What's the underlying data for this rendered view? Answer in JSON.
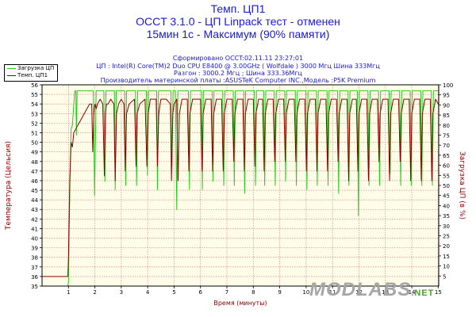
{
  "header": {
    "title_line1": "Темп. ЦП1",
    "title_line2": "OCCT 3.1.0 - ЦП Linpack тест - отменен",
    "title_line3": "15мин 1с - Максимум (90% памяти)",
    "info_line1": "Сформировано OCCT:02.11.11 23:27:01",
    "info_line2": "ЦП : Intel(R) Core(TM)2 Duo CPU E8400 @ 3.00GHz ( Wolfdale ) 3000 Мгц Шина 333Мгц",
    "info_line3": "Разгон : 3000.2 Мгц ; Шина 333.36Мгц",
    "info_line4": "Производитель материнской платы :ASUSTeK Computer INC.,Модель :P5K Premium"
  },
  "legend": {
    "load_label": "Загрузка ЦП",
    "temp_label": "Темп. ЦП1"
  },
  "watermark": {
    "main": "MODLABS",
    "suffix": ".NET"
  },
  "colors": {
    "load": "#22cc22",
    "temp": "#8b0000",
    "axis_left": "#8b0000",
    "axis_right": "#8b0000",
    "grid": "#c87878",
    "plot_bg": "#fffde8"
  },
  "chart_data": {
    "type": "line",
    "xlabel": "Время (минуты)",
    "ylabel_left": "Температура (Цельсия)",
    "ylabel_right": "Загрузка ЦП (в %)",
    "xlim": [
      0,
      15.02
    ],
    "ylim_left": [
      35,
      56
    ],
    "ylim_right": [
      0,
      100
    ],
    "x_ticks": [
      1,
      2,
      3,
      4,
      5,
      6,
      7,
      8,
      9,
      10,
      11,
      12,
      13,
      14,
      15
    ],
    "y_ticks_left": [
      35,
      36,
      37,
      38,
      39,
      40,
      41,
      42,
      43,
      44,
      45,
      46,
      47,
      48,
      49,
      50,
      51,
      52,
      53,
      54,
      55,
      56
    ],
    "y_ticks_right": [
      5,
      10,
      15,
      20,
      25,
      30,
      35,
      40,
      45,
      50,
      55,
      60,
      65,
      70,
      75,
      80,
      85,
      90,
      95,
      100
    ],
    "grid": true,
    "legend_position": "top-left",
    "series": [
      {
        "name": "Загрузка ЦП",
        "axis": "right",
        "x": [
          0,
          0.98,
          1.0,
          1.03,
          1.06,
          1.1,
          1.15,
          1.2,
          1.24,
          1.28,
          1.3,
          1.33,
          1.36,
          1.4,
          1.45,
          1.5,
          1.54,
          1.57,
          1.62,
          1.9,
          1.94,
          1.99,
          2.05,
          2.3,
          2.34,
          2.38,
          2.42,
          2.7,
          2.74,
          2.77,
          2.81,
          3.1,
          3.13,
          3.17,
          3.2,
          3.5,
          3.54,
          3.58,
          3.62,
          3.9,
          3.95,
          3.99,
          4.03,
          4.3,
          4.34,
          4.37,
          4.41,
          4.85,
          4.88,
          4.92,
          4.96,
          5.0,
          5.05,
          5.1,
          5.14,
          5.5,
          5.54,
          5.58,
          5.62,
          6.0,
          6.04,
          6.07,
          6.11,
          6.4,
          6.44,
          6.47,
          6.51,
          6.8,
          6.84,
          6.88,
          6.92,
          7.2,
          7.24,
          7.28,
          7.32,
          7.6,
          7.64,
          7.67,
          7.71,
          8.0,
          8.04,
          8.08,
          8.12,
          8.35,
          8.39,
          8.43,
          8.47,
          8.75,
          8.79,
          8.83,
          8.87,
          9.15,
          9.19,
          9.22,
          9.26,
          9.55,
          9.59,
          9.63,
          9.67,
          9.95,
          9.99,
          10.03,
          10.07,
          10.35,
          10.39,
          10.42,
          10.46,
          10.75,
          10.79,
          10.83,
          10.87,
          11.15,
          11.19,
          11.23,
          11.27,
          11.55,
          11.59,
          11.62,
          11.66,
          11.9,
          11.94,
          11.98,
          12.02,
          12.3,
          12.34,
          12.38,
          12.42,
          12.7,
          12.74,
          12.78,
          12.82,
          13.1,
          13.14,
          13.18,
          13.22,
          13.5,
          13.54,
          13.58,
          13.62,
          13.9,
          13.94,
          13.98,
          14.02,
          14.3,
          14.34,
          14.38,
          14.42,
          14.7,
          14.74,
          14.78,
          14.82,
          15.0
        ],
        "values": [
          0,
          0,
          2,
          30,
          55,
          78,
          80,
          90,
          97,
          97,
          75,
          97,
          97,
          97,
          97,
          97,
          97,
          97,
          97,
          97,
          97,
          45,
          97,
          97,
          97,
          52,
          97,
          97,
          97,
          48,
          97,
          97,
          97,
          50,
          97,
          97,
          97,
          50,
          97,
          97,
          97,
          55,
          97,
          97,
          97,
          48,
          97,
          97,
          97,
          60,
          97,
          97,
          97,
          38,
          97,
          97,
          97,
          48,
          97,
          97,
          97,
          48,
          97,
          97,
          97,
          52,
          97,
          97,
          97,
          50,
          97,
          97,
          97,
          50,
          97,
          97,
          97,
          46,
          97,
          97,
          97,
          50,
          97,
          97,
          97,
          50,
          97,
          97,
          97,
          50,
          97,
          97,
          97,
          52,
          97,
          97,
          97,
          50,
          97,
          97,
          97,
          48,
          97,
          97,
          97,
          50,
          97,
          97,
          97,
          50,
          97,
          97,
          97,
          46,
          97,
          97,
          97,
          50,
          97,
          97,
          97,
          35,
          97,
          97,
          97,
          50,
          97,
          97,
          97,
          50,
          97,
          97,
          97,
          56,
          97,
          97,
          97,
          50,
          97,
          97,
          97,
          50,
          97,
          97,
          97,
          50,
          97,
          97,
          97,
          50,
          97,
          97
        ]
      },
      {
        "name": "Темп. ЦП1",
        "axis": "left",
        "x": [
          0,
          0.98,
          1.0,
          1.05,
          1.1,
          1.15,
          1.2,
          1.3,
          1.4,
          1.5,
          1.6,
          1.7,
          1.8,
          1.88,
          1.92,
          1.96,
          2.0,
          2.05,
          2.1,
          2.2,
          2.3,
          2.36,
          2.4,
          2.44,
          2.5,
          2.6,
          2.72,
          2.77,
          2.82,
          2.9,
          3.0,
          3.1,
          3.15,
          3.2,
          3.3,
          3.5,
          3.56,
          3.6,
          3.7,
          3.9,
          3.97,
          4.02,
          4.1,
          4.32,
          4.37,
          4.42,
          4.5,
          4.7,
          4.86,
          4.9,
          4.95,
          5.0,
          5.1,
          5.15,
          5.2,
          5.3,
          5.5,
          5.56,
          5.6,
          5.7,
          6.0,
          6.06,
          6.1,
          6.2,
          6.4,
          6.46,
          6.5,
          6.6,
          6.8,
          6.86,
          6.9,
          7.0,
          7.2,
          7.26,
          7.3,
          7.4,
          7.6,
          7.66,
          7.7,
          7.8,
          8.0,
          8.06,
          8.1,
          8.2,
          8.35,
          8.41,
          8.45,
          8.55,
          8.75,
          8.81,
          8.85,
          8.95,
          9.15,
          9.21,
          9.25,
          9.35,
          9.55,
          9.61,
          9.65,
          9.75,
          9.95,
          10.01,
          10.05,
          10.15,
          10.35,
          10.41,
          10.45,
          10.55,
          10.75,
          10.81,
          10.85,
          10.95,
          11.15,
          11.21,
          11.25,
          11.35,
          11.55,
          11.61,
          11.65,
          11.75,
          11.9,
          11.96,
          12.0,
          12.1,
          12.3,
          12.36,
          12.4,
          12.5,
          12.7,
          12.76,
          12.8,
          12.9,
          13.1,
          13.16,
          13.2,
          13.3,
          13.5,
          13.56,
          13.6,
          13.7,
          13.9,
          13.96,
          14.0,
          14.1,
          14.3,
          14.36,
          14.4,
          14.5,
          14.7,
          14.76,
          14.8,
          14.9,
          15.0
        ],
        "values": [
          36,
          36,
          38,
          46,
          50,
          49.5,
          51,
          51.5,
          52,
          52.5,
          53,
          53.5,
          54,
          54,
          49,
          53,
          54,
          53.5,
          54,
          54.5,
          54,
          46.5,
          53,
          54,
          54,
          54.5,
          54,
          46,
          53,
          54,
          54.5,
          54,
          47,
          53,
          54,
          54.5,
          47.5,
          53,
          54,
          54.5,
          47.5,
          53,
          54.5,
          54.5,
          47.5,
          53,
          54.5,
          54.5,
          54,
          46,
          53,
          54,
          54.5,
          46,
          53,
          54.5,
          54.5,
          47,
          53,
          54.5,
          54.5,
          47,
          53,
          54.5,
          54.5,
          47,
          53,
          54.5,
          54.5,
          47,
          53,
          54.5,
          54.5,
          48,
          53,
          54.5,
          54.5,
          47,
          53,
          54.5,
          54.5,
          47.5,
          53,
          54.5,
          54.5,
          47,
          53,
          54.5,
          54.5,
          48,
          53,
          54.5,
          54.5,
          48,
          53,
          54.5,
          54.5,
          48,
          53,
          54.5,
          54.5,
          47,
          53,
          54.5,
          54.5,
          47,
          53,
          54.5,
          54.5,
          47,
          53,
          54.5,
          54.5,
          48,
          53,
          54.5,
          54.5,
          46,
          53,
          54.5,
          54.5,
          47,
          53,
          54.5,
          54.5,
          46,
          53,
          54.5,
          54.5,
          48,
          53,
          54.5,
          54.5,
          46,
          53,
          54.5,
          54.5,
          48,
          53,
          54.5,
          54.5,
          46,
          53,
          54.5,
          54.5,
          46,
          53,
          54.5,
          54.5,
          46,
          53,
          54.5,
          54
        ]
      }
    ]
  }
}
